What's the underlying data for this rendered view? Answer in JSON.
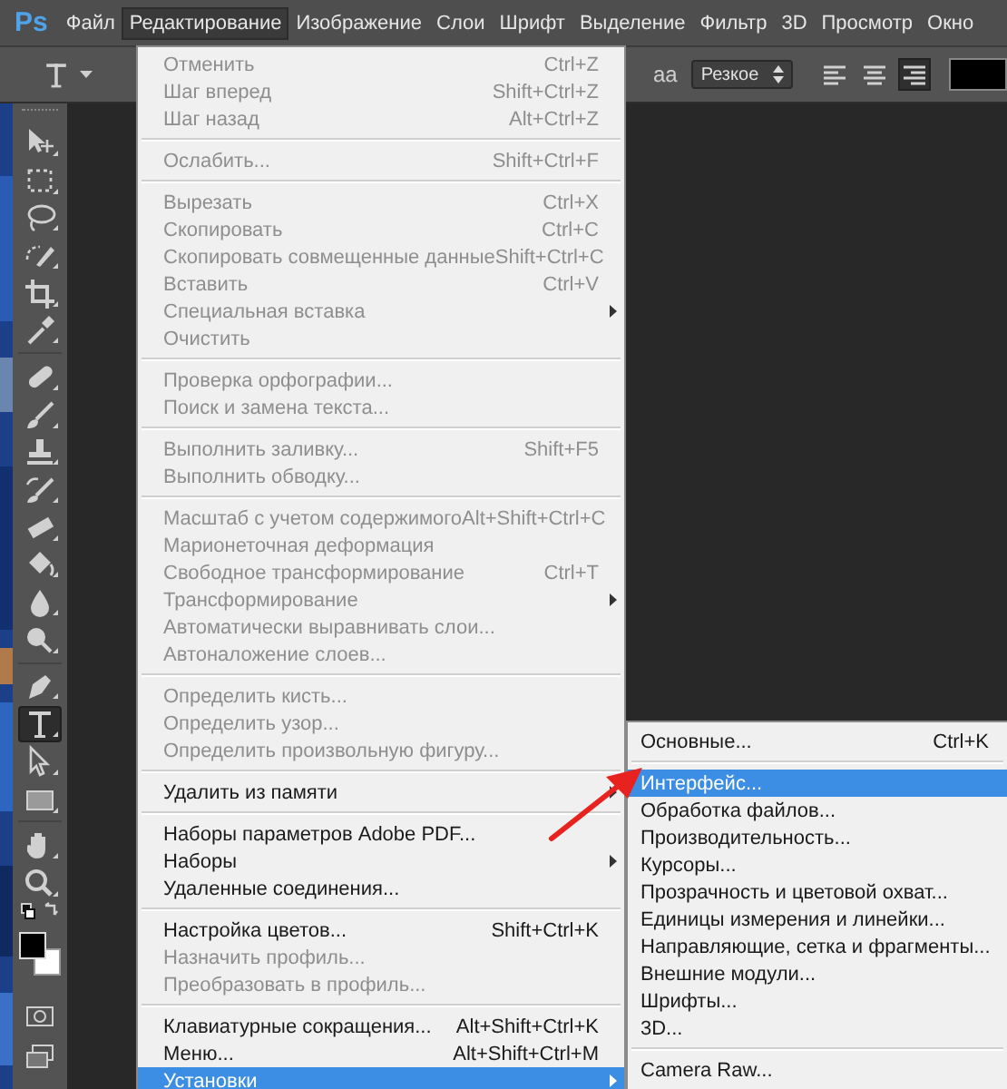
{
  "menubar": {
    "logo": "Ps",
    "items": [
      {
        "label": "Файл",
        "selected": false
      },
      {
        "label": "Редактирование",
        "selected": true
      },
      {
        "label": "Изображение",
        "selected": false
      },
      {
        "label": "Слои",
        "selected": false
      },
      {
        "label": "Шрифт",
        "selected": false
      },
      {
        "label": "Выделение",
        "selected": false
      },
      {
        "label": "Фильтр",
        "selected": false
      },
      {
        "label": "3D",
        "selected": false
      },
      {
        "label": "Просмотр",
        "selected": false
      },
      {
        "label": "Окно",
        "selected": false
      }
    ]
  },
  "options_bar": {
    "antialias_label": "aa",
    "antialias": "Резкое",
    "align": [
      {
        "kind": "left",
        "selected": false
      },
      {
        "kind": "center",
        "selected": false
      },
      {
        "kind": "right",
        "selected": true
      }
    ]
  },
  "tool_groups": [
    [
      {
        "kind": "move",
        "selected": false
      },
      {
        "kind": "marquee",
        "selected": false
      },
      {
        "kind": "lasso",
        "selected": false
      },
      {
        "kind": "quick-select",
        "selected": false
      },
      {
        "kind": "crop",
        "selected": false
      },
      {
        "kind": "eyedropper",
        "selected": false
      }
    ],
    [
      {
        "kind": "healing",
        "selected": false
      },
      {
        "kind": "brush",
        "selected": false
      },
      {
        "kind": "stamp",
        "selected": false
      },
      {
        "kind": "history-brush",
        "selected": false
      },
      {
        "kind": "eraser",
        "selected": false
      },
      {
        "kind": "bucket",
        "selected": false
      },
      {
        "kind": "blur",
        "selected": false
      },
      {
        "kind": "dodge",
        "selected": false
      }
    ],
    [
      {
        "kind": "pen",
        "selected": false
      },
      {
        "kind": "type",
        "selected": true
      },
      {
        "kind": "path-select",
        "selected": false
      },
      {
        "kind": "rectangle",
        "selected": false
      }
    ],
    [
      {
        "kind": "hand",
        "selected": false
      },
      {
        "kind": "zoom",
        "selected": false
      }
    ]
  ],
  "edit_menu": {
    "groups": [
      [
        {
          "label": "Отменить",
          "shortcut": "Ctrl+Z",
          "submenu": false,
          "disabled": true,
          "selected": false
        },
        {
          "label": "Шаг вперед",
          "shortcut": "Shift+Ctrl+Z",
          "submenu": false,
          "disabled": true,
          "selected": false
        },
        {
          "label": "Шаг назад",
          "shortcut": "Alt+Ctrl+Z",
          "submenu": false,
          "disabled": true,
          "selected": false
        }
      ],
      [
        {
          "label": "Ослабить...",
          "shortcut": "Shift+Ctrl+F",
          "submenu": false,
          "disabled": true,
          "selected": false
        }
      ],
      [
        {
          "label": "Вырезать",
          "shortcut": "Ctrl+X",
          "submenu": false,
          "disabled": true,
          "selected": false
        },
        {
          "label": "Скопировать",
          "shortcut": "Ctrl+C",
          "submenu": false,
          "disabled": true,
          "selected": false
        },
        {
          "label": "Скопировать совмещенные данные",
          "shortcut": "Shift+Ctrl+C",
          "submenu": false,
          "disabled": true,
          "selected": false
        },
        {
          "label": "Вставить",
          "shortcut": "Ctrl+V",
          "submenu": false,
          "disabled": true,
          "selected": false
        },
        {
          "label": "Специальная вставка",
          "submenu": true,
          "disabled": true,
          "selected": false
        },
        {
          "label": "Очистить",
          "submenu": false,
          "disabled": true,
          "selected": false
        }
      ],
      [
        {
          "label": "Проверка орфографии...",
          "submenu": false,
          "disabled": true,
          "selected": false
        },
        {
          "label": "Поиск и замена текста...",
          "submenu": false,
          "disabled": true,
          "selected": false
        }
      ],
      [
        {
          "label": "Выполнить заливку...",
          "shortcut": "Shift+F5",
          "submenu": false,
          "disabled": true,
          "selected": false
        },
        {
          "label": "Выполнить обводку...",
          "submenu": false,
          "disabled": true,
          "selected": false
        }
      ],
      [
        {
          "label": "Масштаб с учетом содержимого",
          "shortcut": "Alt+Shift+Ctrl+C",
          "submenu": false,
          "disabled": true,
          "selected": false
        },
        {
          "label": "Марионеточная деформация",
          "submenu": false,
          "disabled": true,
          "selected": false
        },
        {
          "label": "Свободное трансформирование",
          "shortcut": "Ctrl+T",
          "submenu": false,
          "disabled": true,
          "selected": false
        },
        {
          "label": "Трансформирование",
          "submenu": true,
          "disabled": true,
          "selected": false
        },
        {
          "label": "Автоматически выравнивать слои...",
          "submenu": false,
          "disabled": true,
          "selected": false
        },
        {
          "label": "Автоналожение слоев...",
          "submenu": false,
          "disabled": true,
          "selected": false
        }
      ],
      [
        {
          "label": "Определить кисть...",
          "submenu": false,
          "disabled": true,
          "selected": false
        },
        {
          "label": "Определить узор...",
          "submenu": false,
          "disabled": true,
          "selected": false
        },
        {
          "label": "Определить произвольную фигуру...",
          "submenu": false,
          "disabled": true,
          "selected": false
        }
      ],
      [
        {
          "label": "Удалить из памяти",
          "submenu": true,
          "disabled": false,
          "selected": false
        }
      ],
      [
        {
          "label": "Наборы параметров Adobe PDF...",
          "submenu": false,
          "disabled": false,
          "selected": false
        },
        {
          "label": "Наборы",
          "submenu": true,
          "disabled": false,
          "selected": false
        },
        {
          "label": "Удаленные соединения...",
          "submenu": false,
          "disabled": false,
          "selected": false
        }
      ],
      [
        {
          "label": "Настройка цветов...",
          "shortcut": "Shift+Ctrl+K",
          "submenu": false,
          "disabled": false,
          "selected": false
        },
        {
          "label": "Назначить профиль...",
          "submenu": false,
          "disabled": true,
          "selected": false
        },
        {
          "label": "Преобразовать в профиль...",
          "submenu": false,
          "disabled": true,
          "selected": false
        }
      ],
      [
        {
          "label": "Клавиатурные сокращения...",
          "shortcut": "Alt+Shift+Ctrl+K",
          "submenu": false,
          "disabled": false,
          "selected": false
        },
        {
          "label": "Меню...",
          "shortcut": "Alt+Shift+Ctrl+M",
          "submenu": false,
          "disabled": false,
          "selected": false
        },
        {
          "label": "Установки",
          "submenu": true,
          "disabled": false,
          "selected": true
        }
      ]
    ]
  },
  "preferences_submenu": {
    "groups": [
      [
        {
          "label": "Основные...",
          "shortcut": "Ctrl+K",
          "selected": false
        }
      ],
      [
        {
          "label": "Интерфейс...",
          "selected": true
        },
        {
          "label": "Обработка файлов...",
          "selected": false
        },
        {
          "label": "Производительность...",
          "selected": false
        },
        {
          "label": "Курсоры...",
          "selected": false
        },
        {
          "label": "Прозрачность и цветовой охват...",
          "selected": false
        },
        {
          "label": "Единицы измерения и линейки...",
          "selected": false
        },
        {
          "label": "Направляющие, сетка и фрагменты...",
          "selected": false
        },
        {
          "label": "Внешние модули...",
          "selected": false
        },
        {
          "label": "Шрифты...",
          "selected": false
        },
        {
          "label": "3D...",
          "selected": false
        }
      ],
      [
        {
          "label": "Camera Raw...",
          "selected": false
        }
      ]
    ]
  }
}
